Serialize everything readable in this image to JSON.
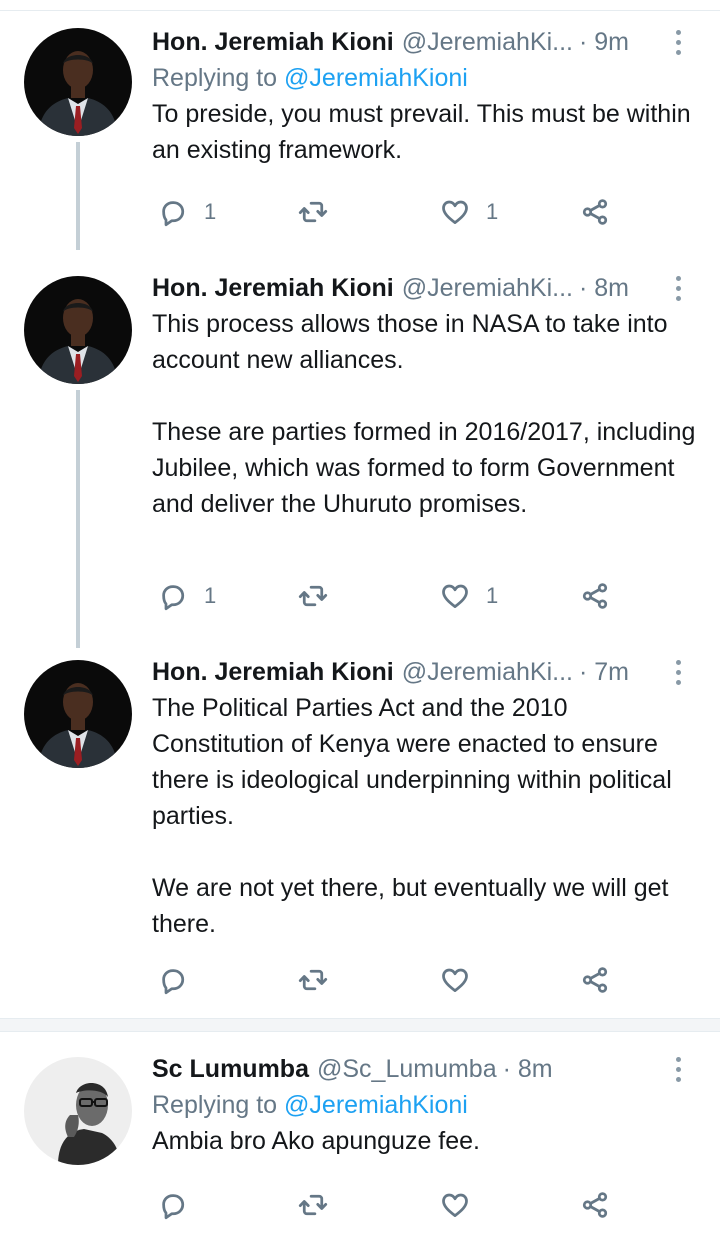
{
  "tweets": [
    {
      "name": "Hon. Jeremiah Kioni",
      "handle": "@JeremiahKi...",
      "time": "· 9m",
      "replying_prefix": "Replying to ",
      "replying_to": "@JeremiahKioni",
      "text": "To preside, you must prevail. This must be within an existing framework.",
      "replies": "1",
      "retweets": "",
      "likes": "1"
    },
    {
      "name": "Hon. Jeremiah Kioni",
      "handle": "@JeremiahKi...",
      "time": "· 8m",
      "text": "This process allows those in NASA to take into account new alliances.\n\nThese are parties formed in 2016/2017, including Jubilee, which was formed to form Government and deliver the Uhuruto promises.",
      "replies": "1",
      "retweets": "",
      "likes": "1"
    },
    {
      "name": "Hon. Jeremiah Kioni",
      "handle": "@JeremiahKi...",
      "time": "· 7m",
      "text": "The Political Parties Act and the 2010 Constitution of Kenya were enacted to ensure there is ideological underpinning within political parties.\n\nWe are not yet there, but eventually we will get there.",
      "replies": "",
      "retweets": "",
      "likes": ""
    },
    {
      "name": "Sc Lumumba",
      "handle": "@Sc_Lumumba",
      "time": "· 8m",
      "replying_prefix": "Replying to ",
      "replying_to": "@JeremiahKioni",
      "text": "Ambia bro Ako apunguze fee.",
      "replies": "",
      "retweets": "",
      "likes": ""
    }
  ],
  "icons": {
    "reply": "reply-icon",
    "retweet": "retweet-icon",
    "like": "heart-icon",
    "share": "share-icon",
    "more": "more-vertical-icon"
  },
  "colors": {
    "link": "#1da1f2",
    "secondary_text": "#657786",
    "thread_line": "#c4cfd6",
    "divider": "#e6ecf0"
  }
}
